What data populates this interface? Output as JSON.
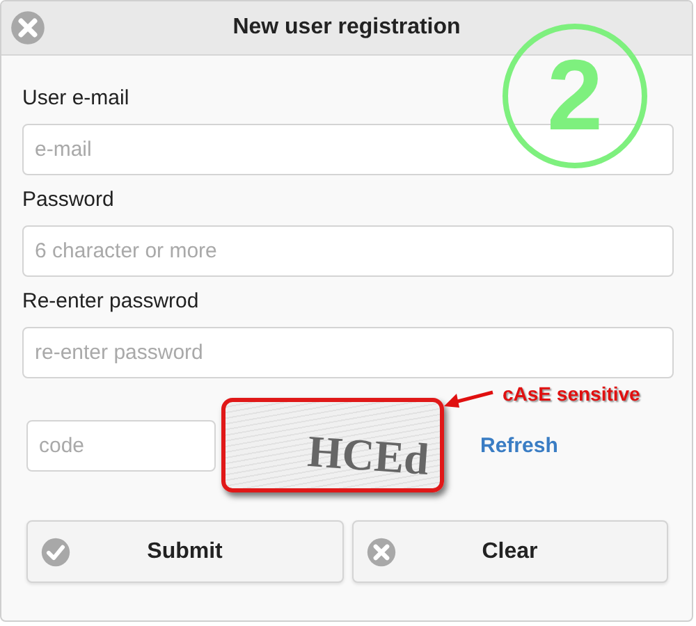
{
  "window": {
    "title": "New user registration"
  },
  "fields": [
    {
      "label": "User e-mail",
      "placeholder": "e-mail"
    },
    {
      "label": "Password",
      "placeholder": "6 character or more"
    },
    {
      "label": "Re-enter passwrod",
      "placeholder": "re-enter password"
    }
  ],
  "captcha": {
    "placeholder": "code",
    "image_text": "HCEd",
    "link": "Refresh"
  },
  "buttons": [
    {
      "label": "Submit",
      "kind": "check"
    },
    {
      "label": "Clear",
      "kind": "cross"
    }
  ],
  "annotations": [
    {
      "kind": "step",
      "text": "2"
    },
    {
      "kind": "callout",
      "text": "cAsE sensitive"
    }
  ]
}
